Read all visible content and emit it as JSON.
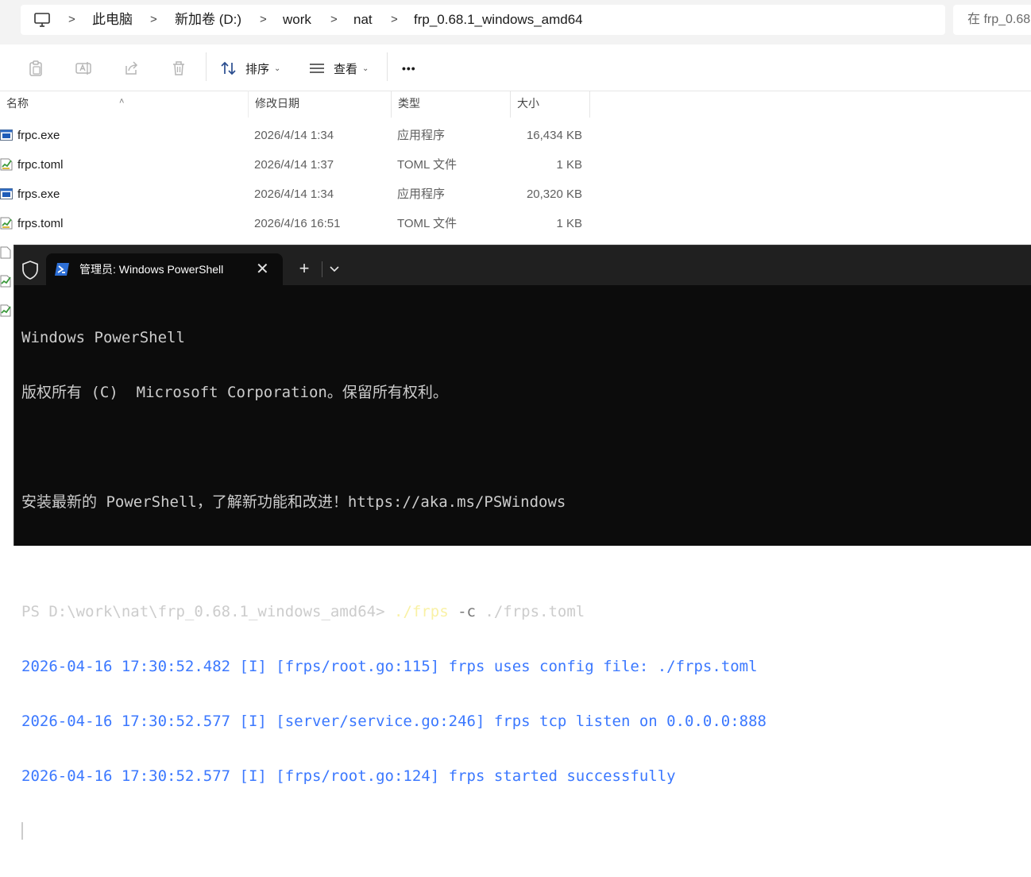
{
  "explorer": {
    "breadcrumb": [
      "此电脑",
      "新加卷 (D:)",
      "work",
      "nat",
      "frp_0.68.1_windows_amd64"
    ],
    "search_placeholder": "在 frp_0.68",
    "toolbar": {
      "sort_label": "排序",
      "view_label": "查看",
      "more_label": "•••"
    },
    "columns": {
      "name": "名称",
      "modified": "修改日期",
      "type": "类型",
      "size": "大小"
    },
    "files": [
      {
        "name": "frpc.exe",
        "modified": "2026/4/14 1:34",
        "type": "应用程序",
        "size": "16,434 KB",
        "icon": "exe-icon"
      },
      {
        "name": "frpc.toml",
        "modified": "2026/4/14 1:37",
        "type": "TOML 文件",
        "size": "1 KB",
        "icon": "toml-file-icon"
      },
      {
        "name": "frps.exe",
        "modified": "2026/4/14 1:34",
        "type": "应用程序",
        "size": "20,320 KB",
        "icon": "exe-icon"
      },
      {
        "name": "frps.toml",
        "modified": "2026/4/16 16:51",
        "type": "TOML 文件",
        "size": "1 KB",
        "icon": "toml-file-icon"
      }
    ]
  },
  "terminal": {
    "tab_title": "管理员: Windows PowerShell",
    "tab_close": "✕",
    "new_tab": "+",
    "dropdown": "⌄",
    "lines": {
      "l1": "Windows PowerShell",
      "l2": "版权所有 (C)  Microsoft Corporation。保留所有权利。",
      "l3": "安装最新的 PowerShell，了解新功能和改进！https://aka.ms/PSWindows",
      "prompt": "PS D:\\work\\nat\\frp_0.68.1_windows_amd64> ",
      "cmd": "./frps",
      "flag": " -c",
      "arg": " ./frps.toml",
      "log1": "2026-04-16 17:30:52.482 [I] [frps/root.go:115] frps uses config file: ./frps.toml",
      "log2": "2026-04-16 17:30:52.577 [I] [server/service.go:246] frps tcp listen on 0.0.0.0:888",
      "log3": "2026-04-16 17:30:52.577 [I] [frps/root.go:124] frps started successfully"
    }
  },
  "colors": {
    "console_bg": "#0c0c0c",
    "console_text": "#cccccc",
    "log_blue": "#3b78ff",
    "cmd_yellow": "#f9f1a5",
    "tabbar_bg": "#202020"
  }
}
